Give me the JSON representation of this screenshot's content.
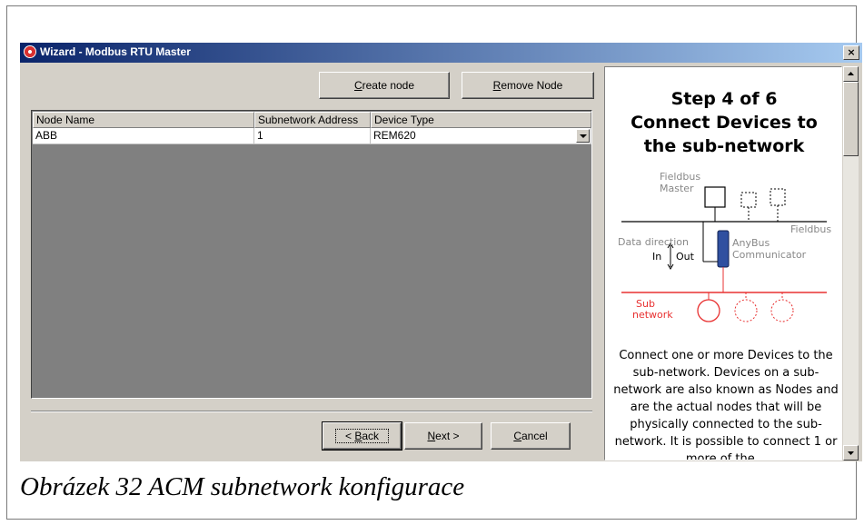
{
  "window": {
    "title": "Wizard - Modbus RTU Master",
    "close_label": "×"
  },
  "toolbar": {
    "create_prefix": "",
    "create_accel": "C",
    "create_rest": "reate node",
    "remove_accel": "R",
    "remove_rest": "emove Node"
  },
  "grid": {
    "columns": [
      "Node Name",
      "Subnetwork Address",
      "Device Type"
    ],
    "rows": [
      {
        "name": "ABB",
        "address": "1",
        "device_type": "REM620"
      }
    ]
  },
  "footer": {
    "back_prefix": "< ",
    "back_accel": "B",
    "back_rest": "ack",
    "next_accel": "N",
    "next_rest": "ext >",
    "cancel_accel": "C",
    "cancel_rest": "ancel"
  },
  "help": {
    "heading_lines": [
      "Step 4 of 6",
      "Connect Devices to",
      "the sub-network"
    ],
    "diagram": {
      "fieldbus_master": [
        "Fieldbus",
        "Master"
      ],
      "fieldbus": "Fieldbus",
      "data_direction": "Data direction",
      "in": "In",
      "out": "Out",
      "anybus": [
        "AnyBus",
        "Communicator"
      ],
      "sub_network": [
        "Sub",
        "network"
      ]
    },
    "body": "Connect one or more Devices to the sub-network. Devices on a sub-network are also known as Nodes and are the actual nodes that will be physically connected to the sub-network. It is possible to connect 1 or more of the..."
  },
  "colors": {
    "title_start": "#0a246a",
    "title_end": "#a6caf0",
    "face": "#d4d0c8",
    "grid_bg": "#808080",
    "subnet_red": "#e83030"
  },
  "caption": "Obrázek 32 ACM subnetwork konfigurace"
}
